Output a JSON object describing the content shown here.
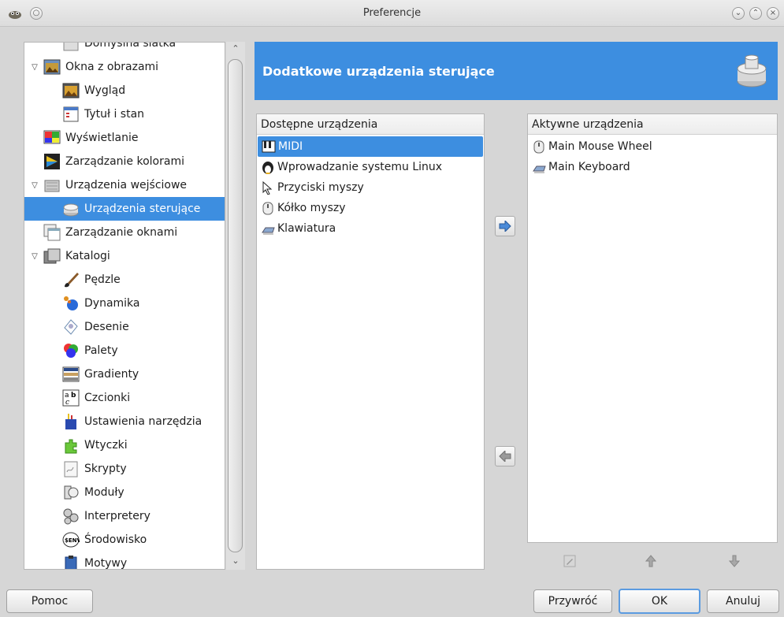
{
  "window": {
    "title": "Preferencje"
  },
  "tree": {
    "items": [
      {
        "label": "Domyślna siatka",
        "level": 1,
        "expander": "",
        "icon": "grid-icon",
        "selected": false,
        "partial": true
      },
      {
        "label": "Okna z obrazami",
        "level": 0,
        "expander": "▽",
        "icon": "image-window-icon",
        "selected": false
      },
      {
        "label": "Wygląd",
        "level": 1,
        "expander": "",
        "icon": "appearance-icon",
        "selected": false
      },
      {
        "label": "Tytuł i stan",
        "level": 1,
        "expander": "",
        "icon": "title-status-icon",
        "selected": false
      },
      {
        "label": "Wyświetlanie",
        "level": 0,
        "expander": "",
        "icon": "display-icon",
        "selected": false
      },
      {
        "label": "Zarządzanie kolorami",
        "level": 0,
        "expander": "",
        "icon": "color-management-icon",
        "selected": false
      },
      {
        "label": "Urządzenia wejściowe",
        "level": 0,
        "expander": "▽",
        "icon": "input-devices-icon",
        "selected": false
      },
      {
        "label": "Urządzenia sterujące",
        "level": 1,
        "expander": "",
        "icon": "input-controllers-icon",
        "selected": true
      },
      {
        "label": "Zarządzanie oknami",
        "level": 0,
        "expander": "",
        "icon": "window-management-icon",
        "selected": false
      },
      {
        "label": "Katalogi",
        "level": 0,
        "expander": "▽",
        "icon": "folders-icon",
        "selected": false
      },
      {
        "label": "Pędzle",
        "level": 1,
        "expander": "",
        "icon": "brushes-icon",
        "selected": false
      },
      {
        "label": "Dynamika",
        "level": 1,
        "expander": "",
        "icon": "dynamics-icon",
        "selected": false
      },
      {
        "label": "Desenie",
        "level": 1,
        "expander": "",
        "icon": "patterns-icon",
        "selected": false
      },
      {
        "label": "Palety",
        "level": 1,
        "expander": "",
        "icon": "palettes-icon",
        "selected": false
      },
      {
        "label": "Gradienty",
        "level": 1,
        "expander": "",
        "icon": "gradients-icon",
        "selected": false
      },
      {
        "label": "Czcionki",
        "level": 1,
        "expander": "",
        "icon": "fonts-icon",
        "selected": false
      },
      {
        "label": "Ustawienia narzędzia",
        "level": 1,
        "expander": "",
        "icon": "tool-presets-icon",
        "selected": false
      },
      {
        "label": "Wtyczki",
        "level": 1,
        "expander": "",
        "icon": "plugins-icon",
        "selected": false
      },
      {
        "label": "Skrypty",
        "level": 1,
        "expander": "",
        "icon": "scripts-icon",
        "selected": false
      },
      {
        "label": "Moduły",
        "level": 1,
        "expander": "",
        "icon": "modules-icon",
        "selected": false
      },
      {
        "label": "Interpretery",
        "level": 1,
        "expander": "",
        "icon": "interpreters-icon",
        "selected": false
      },
      {
        "label": "Środowisko",
        "level": 1,
        "expander": "",
        "icon": "environment-icon",
        "selected": false
      },
      {
        "label": "Motywy",
        "level": 1,
        "expander": "",
        "icon": "themes-icon",
        "selected": false
      }
    ]
  },
  "header": {
    "title": "Dodatkowe urządzenia sterujące",
    "icon": "input-controllers-icon"
  },
  "available": {
    "header": "Dostępne urządzenia",
    "items": [
      {
        "label": "MIDI",
        "icon": "midi-icon",
        "selected": true
      },
      {
        "label": "Wprowadzanie systemu Linux",
        "icon": "linux-input-icon",
        "selected": false
      },
      {
        "label": "Przyciski myszy",
        "icon": "mouse-pointer-icon",
        "selected": false
      },
      {
        "label": "Kółko myszy",
        "icon": "mouse-wheel-icon",
        "selected": false
      },
      {
        "label": "Klawiatura",
        "icon": "keyboard-icon",
        "selected": false
      }
    ]
  },
  "active": {
    "header": "Aktywne urządzenia",
    "items": [
      {
        "label": "Main Mouse Wheel",
        "icon": "mouse-wheel-icon"
      },
      {
        "label": "Main Keyboard",
        "icon": "keyboard-icon"
      }
    ]
  },
  "buttons": {
    "help": "Pomoc",
    "reset": "Przywróć",
    "ok": "OK",
    "cancel": "Anuluj"
  },
  "colors": {
    "selection": "#3d8ee0",
    "header_bg": "#3d8ee0"
  }
}
